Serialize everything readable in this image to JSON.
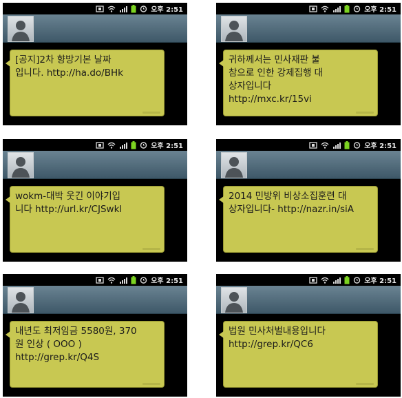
{
  "status_time": "오후 2:51",
  "messages": [
    {
      "text": "[공지]2차 향방기본 날짜\n입니다. http://ha.do/BHk"
    },
    {
      "text": "귀하께서는 민사재판 불\n참으로 인한 강제집행 대\n상자입니다\nhttp://mxc.kr/15vi"
    },
    {
      "text": "wokm-대박 웃긴 이야기입\n니다 http://url.kr/CJSwkl"
    },
    {
      "text": "2014 민방위 비상소집훈련 대\n상자입니다- http://nazr.in/siA"
    },
    {
      "text": "내년도 최저임금 5580원, 370\n원 인상 ( OOO )\nhttp://grep.kr/Q4S"
    },
    {
      "text": "법원 민사처벌내용입니다\nhttp://grep.kr/QC6"
    }
  ],
  "colors": {
    "bubble": "#c8c852",
    "header": "#4e6878",
    "background": "#000000"
  },
  "icons": [
    "screenshot-icon",
    "wifi-icon",
    "signal-icon",
    "battery-icon",
    "alarm-icon",
    "contact-avatar-icon"
  ]
}
